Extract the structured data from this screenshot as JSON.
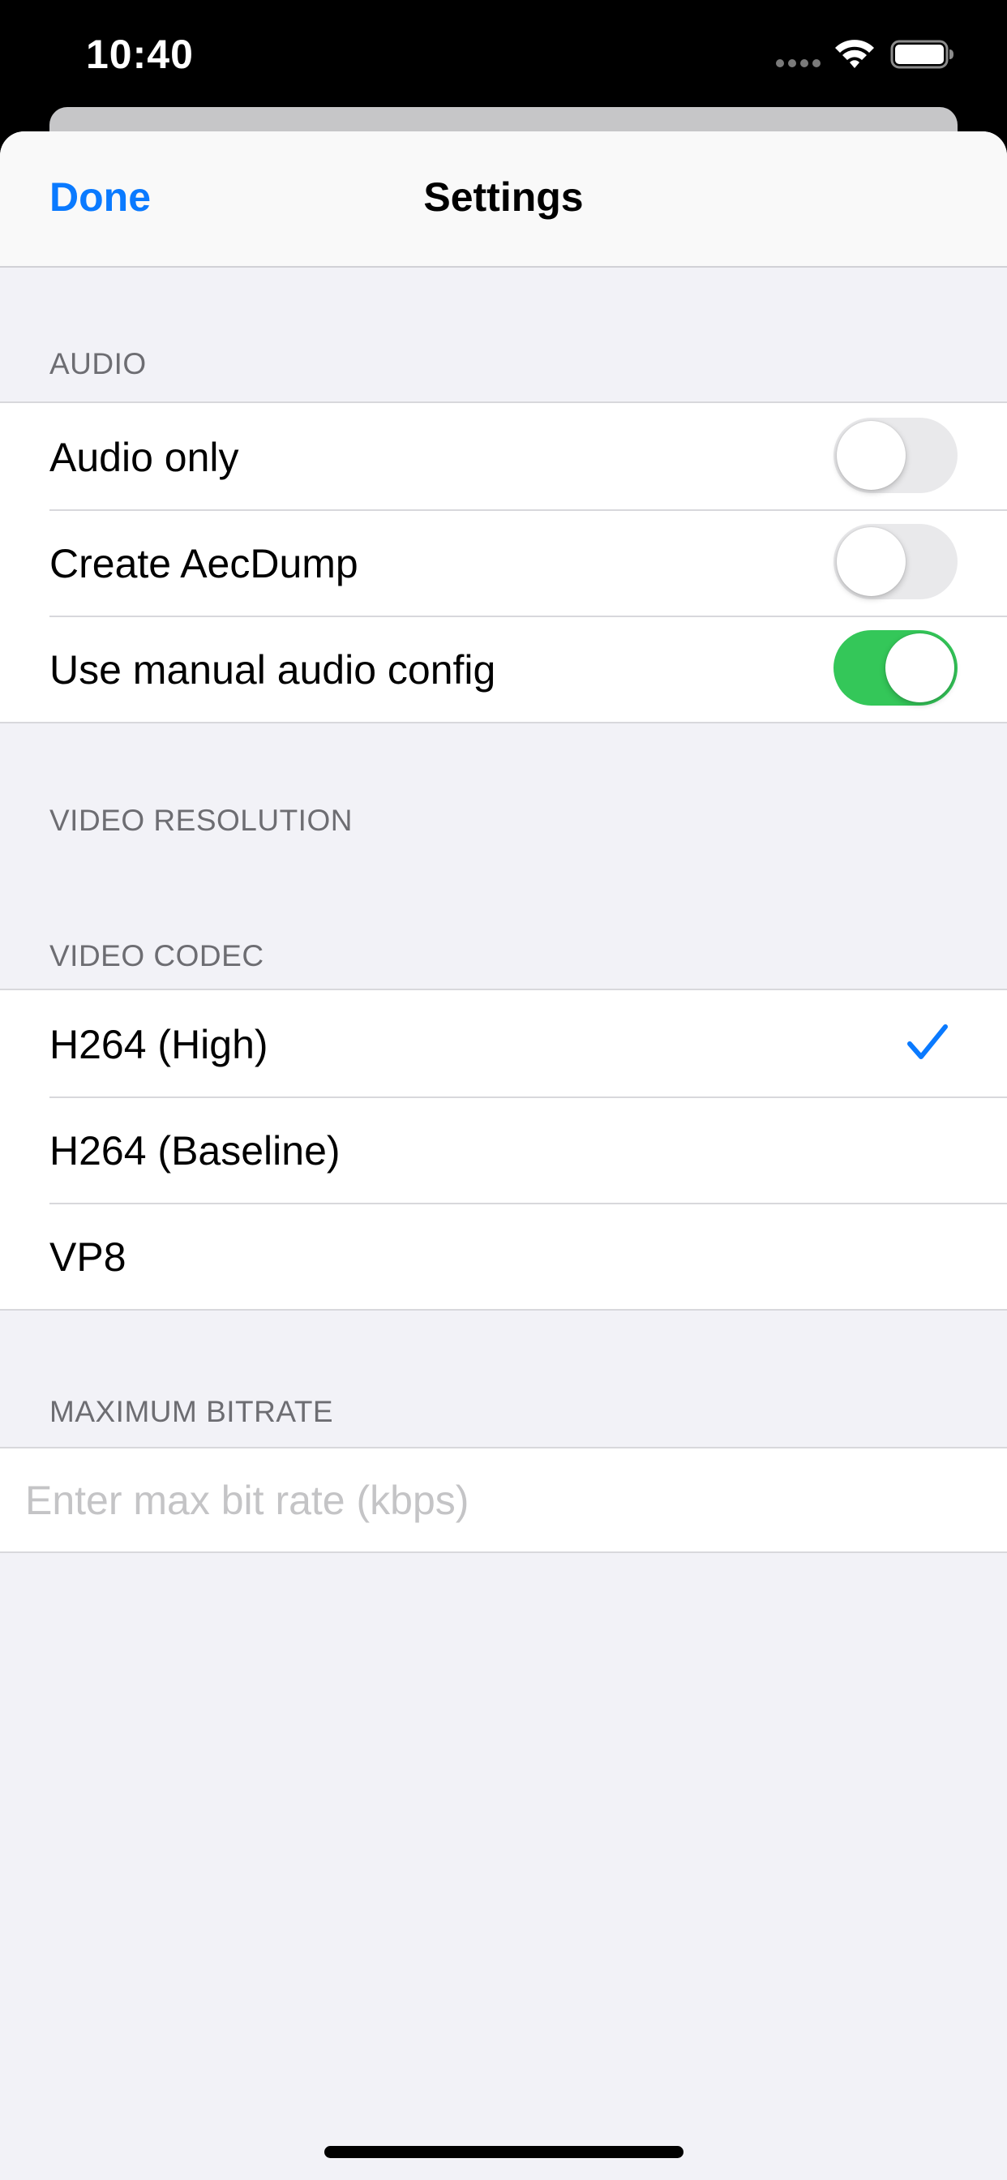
{
  "status_bar": {
    "time": "10:40",
    "icons": [
      "cellular-signal-icon",
      "wifi-icon",
      "battery-icon"
    ]
  },
  "nav": {
    "done_label": "Done",
    "title": "Settings"
  },
  "sections": {
    "audio": {
      "header": "AUDIO",
      "rows": [
        {
          "label": "Audio only",
          "on": false
        },
        {
          "label": "Create AecDump",
          "on": false
        },
        {
          "label": "Use manual audio config",
          "on": true
        }
      ]
    },
    "video_resolution": {
      "header": "VIDEO RESOLUTION"
    },
    "video_codec": {
      "header": "VIDEO CODEC",
      "rows": [
        {
          "label": "H264 (High)",
          "selected": true
        },
        {
          "label": "H264 (Baseline)",
          "selected": false
        },
        {
          "label": "VP8",
          "selected": false
        }
      ]
    },
    "max_bitrate": {
      "header": "MAXIMUM BITRATE",
      "value": "",
      "placeholder": "Enter max bit rate (kbps)"
    }
  },
  "colors": {
    "accent": "#0a7aff",
    "toggle_on": "#34c759",
    "toggle_off": "#e9e9eb",
    "grouped_background": "#f2f2f7",
    "section_header_text": "#6d6d72"
  }
}
